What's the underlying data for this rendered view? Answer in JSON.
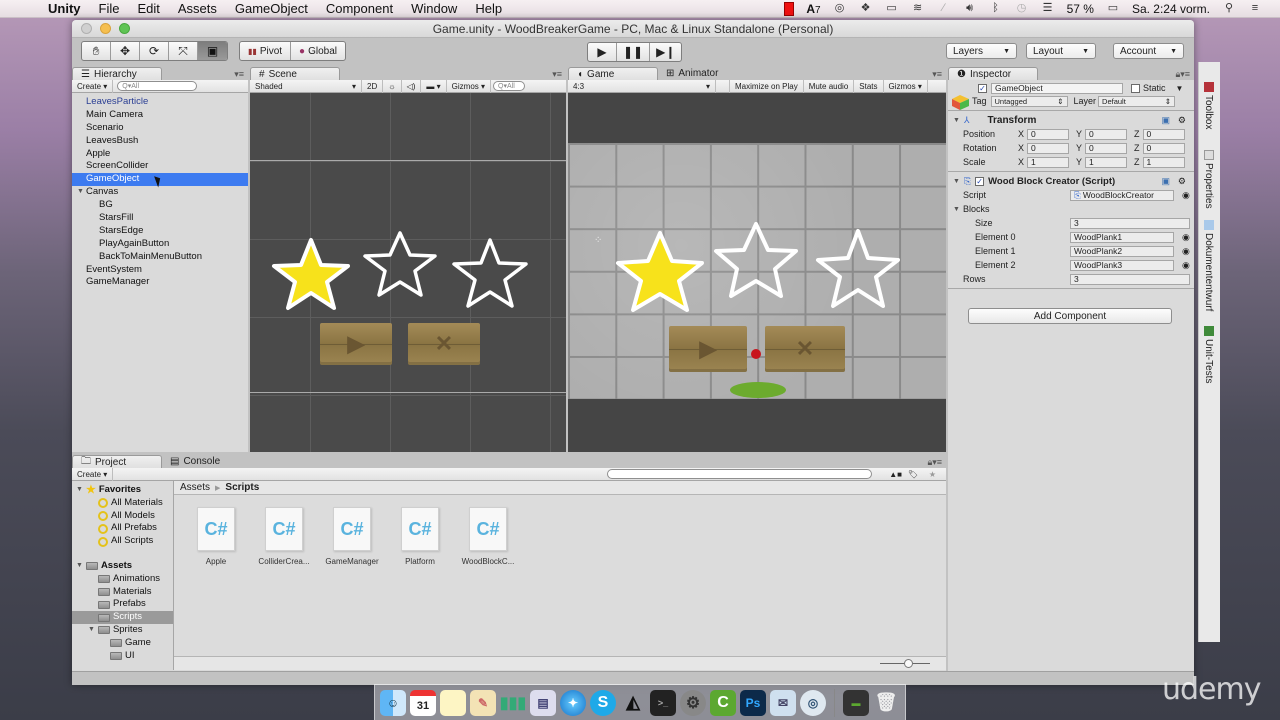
{
  "menubar": {
    "app": "Unity",
    "items": [
      "File",
      "Edit",
      "Assets",
      "GameObject",
      "Component",
      "Window",
      "Help"
    ],
    "status": {
      "adobe_badge": "7",
      "battery": "57 %",
      "clock": "Sa. 2:24 vorm."
    }
  },
  "window": {
    "title": "Game.unity - WoodBreakerGame - PC, Mac & Linux Standalone (Personal)"
  },
  "toolbar": {
    "tools": [
      "hand-tool",
      "move-tool",
      "rotate-tool",
      "scale-tool",
      "rect-tool"
    ],
    "pivot_label": "Pivot",
    "global_label": "Global",
    "layers_label": "Layers",
    "layout_label": "Layout",
    "account_label": "Account"
  },
  "hierarchy": {
    "tab": "Hierarchy",
    "create": "Create",
    "search_placeholder": "Q▾All",
    "items": [
      {
        "label": "LeavesParticle",
        "indent": 0,
        "style": "blue"
      },
      {
        "label": "Main Camera",
        "indent": 0
      },
      {
        "label": "Scenario",
        "indent": 0
      },
      {
        "label": "LeavesBush",
        "indent": 0
      },
      {
        "label": "Apple",
        "indent": 0
      },
      {
        "label": "ScreenCollider",
        "indent": 0
      },
      {
        "label": "GameObject",
        "indent": 0,
        "selected": true
      },
      {
        "label": "Canvas",
        "indent": 0,
        "expanded": true
      },
      {
        "label": "BG",
        "indent": 1
      },
      {
        "label": "StarsFill",
        "indent": 1
      },
      {
        "label": "StarsEdge",
        "indent": 1
      },
      {
        "label": "PlayAgainButton",
        "indent": 1
      },
      {
        "label": "BackToMainMenuButton",
        "indent": 1
      },
      {
        "label": "EventSystem",
        "indent": 0
      },
      {
        "label": "GameManager",
        "indent": 0
      }
    ]
  },
  "scene": {
    "tab": "Scene",
    "shading": "Shaded",
    "mode_2d": "2D",
    "gizmos": "Gizmos",
    "search_placeholder": "Q▾All"
  },
  "game": {
    "tab": "Game",
    "tab2": "Animator",
    "aspect": "4:3",
    "maximize": "Maximize on Play",
    "mute": "Mute audio",
    "stats": "Stats",
    "gizmos": "Gizmos",
    "stars_filled": 1,
    "stars_total": 3
  },
  "inspector": {
    "tab": "Inspector",
    "object_name": "GameObject",
    "active": true,
    "static_label": "Static",
    "tag_label": "Tag",
    "tag_value": "Untagged",
    "layer_label": "Layer",
    "layer_value": "Default",
    "transform": {
      "title": "Transform",
      "rows": [
        {
          "label": "Position",
          "x": "0",
          "y": "0",
          "z": "0"
        },
        {
          "label": "Rotation",
          "x": "0",
          "y": "0",
          "z": "0"
        },
        {
          "label": "Scale",
          "x": "1",
          "y": "1",
          "z": "1"
        }
      ]
    },
    "script_component": {
      "title": "Wood Block Creator (Script)",
      "script_label": "Script",
      "script_value": "WoodBlockCreator",
      "blocks_label": "Blocks",
      "size_label": "Size",
      "size_value": "3",
      "elements": [
        {
          "label": "Element 0",
          "value": "WoodPlank1"
        },
        {
          "label": "Element 1",
          "value": "WoodPlank2"
        },
        {
          "label": "Element 2",
          "value": "WoodPlank3"
        }
      ],
      "rows_label": "Rows",
      "rows_value": "3"
    },
    "add_component": "Add Component"
  },
  "side_tabs": [
    "Toolbox",
    "Properties",
    "Dokumententwurf",
    "Unit-Tests"
  ],
  "project": {
    "tab": "Project",
    "tab2": "Console",
    "create": "Create",
    "favorites_label": "Favorites",
    "favorites": [
      "All Materials",
      "All Models",
      "All Prefabs",
      "All Scripts"
    ],
    "assets_label": "Assets",
    "folders": [
      {
        "label": "Animations",
        "indent": 1
      },
      {
        "label": "Materials",
        "indent": 1
      },
      {
        "label": "Prefabs",
        "indent": 1
      },
      {
        "label": "Scripts",
        "indent": 1,
        "selected": true
      },
      {
        "label": "Sprites",
        "indent": 1,
        "expanded": true
      },
      {
        "label": "Game",
        "indent": 2
      },
      {
        "label": "UI",
        "indent": 2
      }
    ],
    "breadcrumb": [
      "Assets",
      "Scripts"
    ],
    "files": [
      "Apple",
      "ColliderCrea...",
      "GameManager",
      "Platform",
      "WoodBlockC..."
    ],
    "file_icon": "C#"
  },
  "watermark": "udemy"
}
